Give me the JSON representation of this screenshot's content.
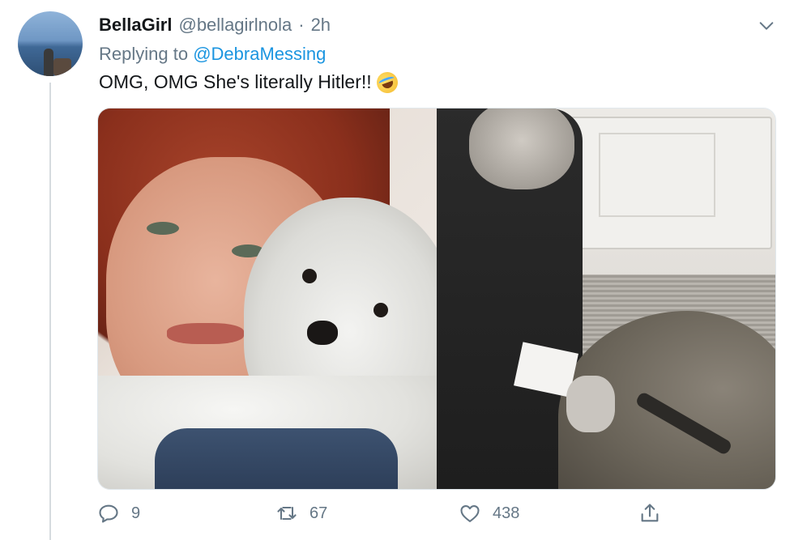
{
  "tweet": {
    "display_name": "BellaGirl",
    "handle": "@bellagirlnola",
    "separator": "·",
    "time": "2h",
    "replying_prefix": "Replying to",
    "replying_to": "@DebraMessing",
    "text": "OMG, OMG She's literally Hitler!!",
    "emoji": "rolling-on-floor-laughing-emoji"
  },
  "media": {
    "left_image": "woman-hugging-white-dog-photo",
    "right_image": "man-petting-german-shepherd-bw-photo"
  },
  "actions": {
    "replies": "9",
    "retweets": "67",
    "likes": "438"
  },
  "colors": {
    "link": "#1b95e0",
    "secondary_text": "#657786",
    "primary_text": "#14171a"
  }
}
